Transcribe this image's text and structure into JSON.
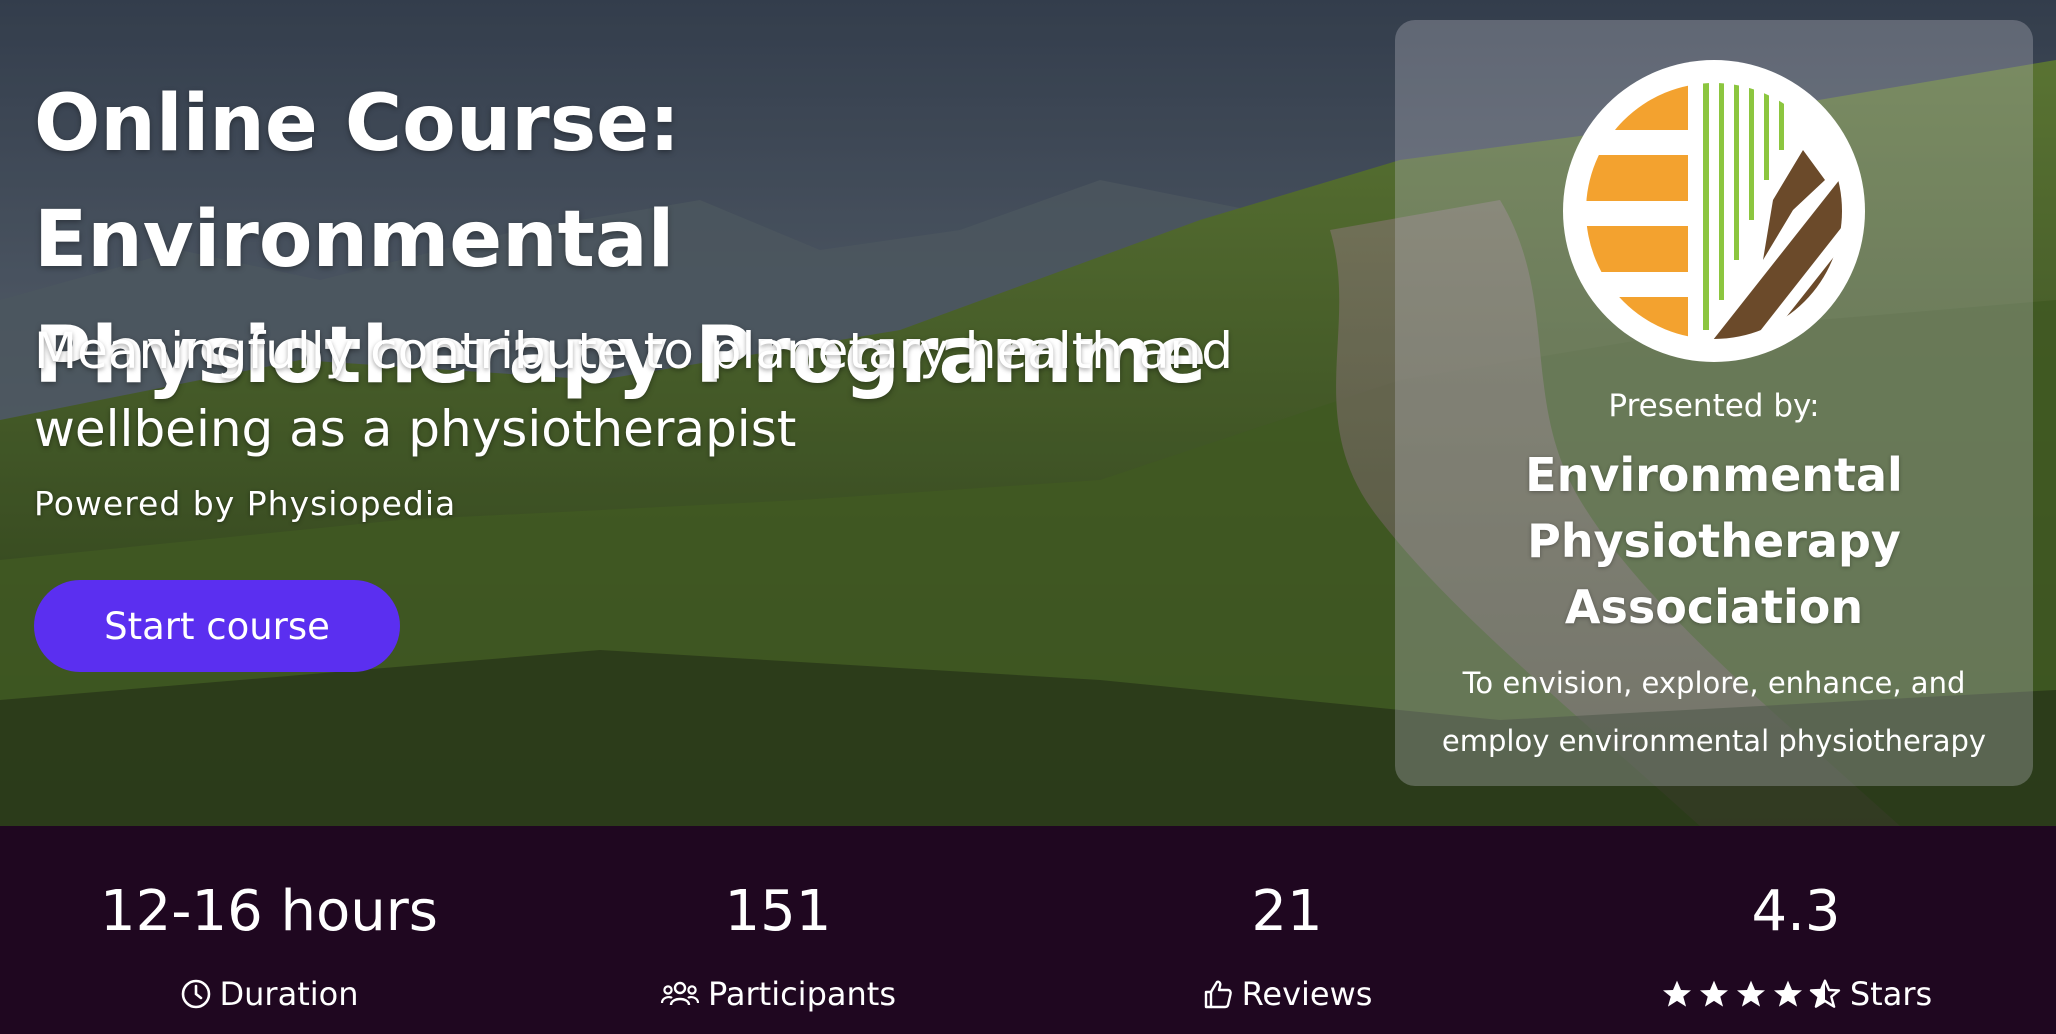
{
  "hero": {
    "title": "Online Course: Environmental Physiotherapy Programme",
    "subtitle": "Meaningfully contribute to planetary health and wellbeing as a physiotherapist",
    "powered_by": "Powered by Physiopedia",
    "start_button_label": "Start course",
    "colors": {
      "button": "#5b2ff0",
      "stats_bar": "#1f0720"
    }
  },
  "presenter": {
    "presented_by_label": "Presented by:",
    "org_name": "Environmental Physiotherapy Association",
    "tagline": "To envision, explore, enhance, and employ environmental physiotherapy",
    "logo_colors": {
      "orange": "#f3a22f",
      "green": "#8cc63f",
      "brown": "#6b4a2a"
    }
  },
  "stats": [
    {
      "value": "12-16 hours",
      "label": "Duration",
      "icon": "clock-icon"
    },
    {
      "value": "151",
      "label": "Participants",
      "icon": "users-icon"
    },
    {
      "value": "21",
      "label": "Reviews",
      "icon": "thumbs-up-icon"
    },
    {
      "value": "4.3",
      "label": "Stars",
      "icon": "star-rating-icon",
      "rating": 4.3,
      "rating_max": 5
    }
  ]
}
